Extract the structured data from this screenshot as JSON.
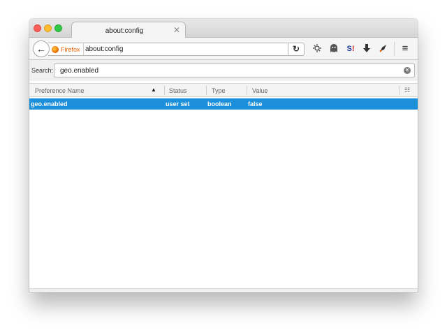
{
  "window": {
    "tab": {
      "title": "about:config",
      "close": "✕"
    }
  },
  "navbar": {
    "back": "←",
    "identity": "Firefox",
    "url": "about:config",
    "reload": "↻",
    "icons": [
      "sync-icon",
      "ghost-icon",
      "s-extension-icon",
      "download-icon",
      "rocket-icon"
    ],
    "menu": "≡"
  },
  "search": {
    "label": "Search:",
    "value": "geo.enabled"
  },
  "table": {
    "columns": [
      "Preference Name",
      "Status",
      "Type",
      "Value"
    ],
    "rows": [
      {
        "name": "geo.enabled",
        "status": "user set",
        "type": "boolean",
        "value": "false"
      }
    ]
  },
  "colors": {
    "selection": "#1c8fdb",
    "identity": "#e66000"
  }
}
